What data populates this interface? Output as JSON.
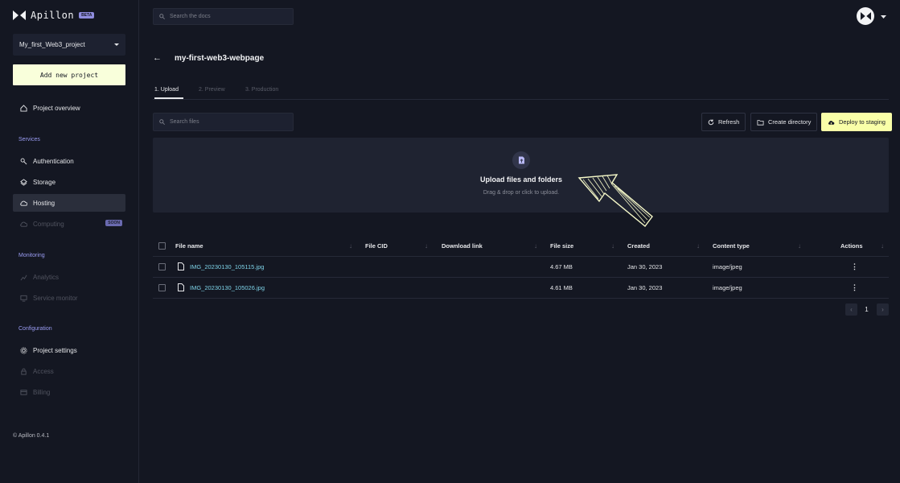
{
  "app": {
    "name": "Apillon",
    "badge": "BETA",
    "version": "© Apillon 0.4.1"
  },
  "sidebar": {
    "project": "My_first_Web3_project",
    "add_project": "Add new project",
    "overview": "Project overview",
    "sections": {
      "services": "Services",
      "monitoring": "Monitoring",
      "configuration": "Configuration"
    },
    "items": {
      "authentication": "Authentication",
      "storage": "Storage",
      "hosting": "Hosting",
      "computing": "Computing",
      "computing_badge": "SOON",
      "analytics": "Analytics",
      "service_monitor": "Service monitor",
      "project_settings": "Project settings",
      "access": "Access",
      "billing": "Billing"
    },
    "active_item": "hosting"
  },
  "header": {
    "search_placeholder": "Search the docs"
  },
  "page": {
    "back": "←",
    "title": "my-first-web3-webpage",
    "tabs": [
      "1. Upload",
      "2. Preview",
      "3. Production"
    ],
    "active_tab": 0
  },
  "toolbar": {
    "search_placeholder": "Search files",
    "refresh": "Refresh",
    "create_directory": "Create directory",
    "deploy": "Deploy to staging"
  },
  "upload": {
    "title": "Upload files and folders",
    "subtitle": "Drag & drop or click to upload."
  },
  "table": {
    "columns": [
      "File name",
      "File CID",
      "Download link",
      "File size",
      "Created",
      "Content type",
      "Actions"
    ],
    "rows": [
      {
        "name": "IMG_20230130_105115.jpg",
        "cid": "",
        "link": "",
        "size": "4.67 MB",
        "created": "Jan 30, 2023",
        "type": "image/jpeg"
      },
      {
        "name": "IMG_20230130_105026.jpg",
        "cid": "",
        "link": "",
        "size": "4.61 MB",
        "created": "Jan 30, 2023",
        "type": "image/jpeg"
      }
    ]
  },
  "pagination": {
    "prev": "‹",
    "page": "1",
    "next": "›"
  },
  "colors": {
    "background": "#141722",
    "accent_yellow": "#f9ffa8",
    "link": "#7ed3e8",
    "section_label": "#9a9cf2"
  }
}
